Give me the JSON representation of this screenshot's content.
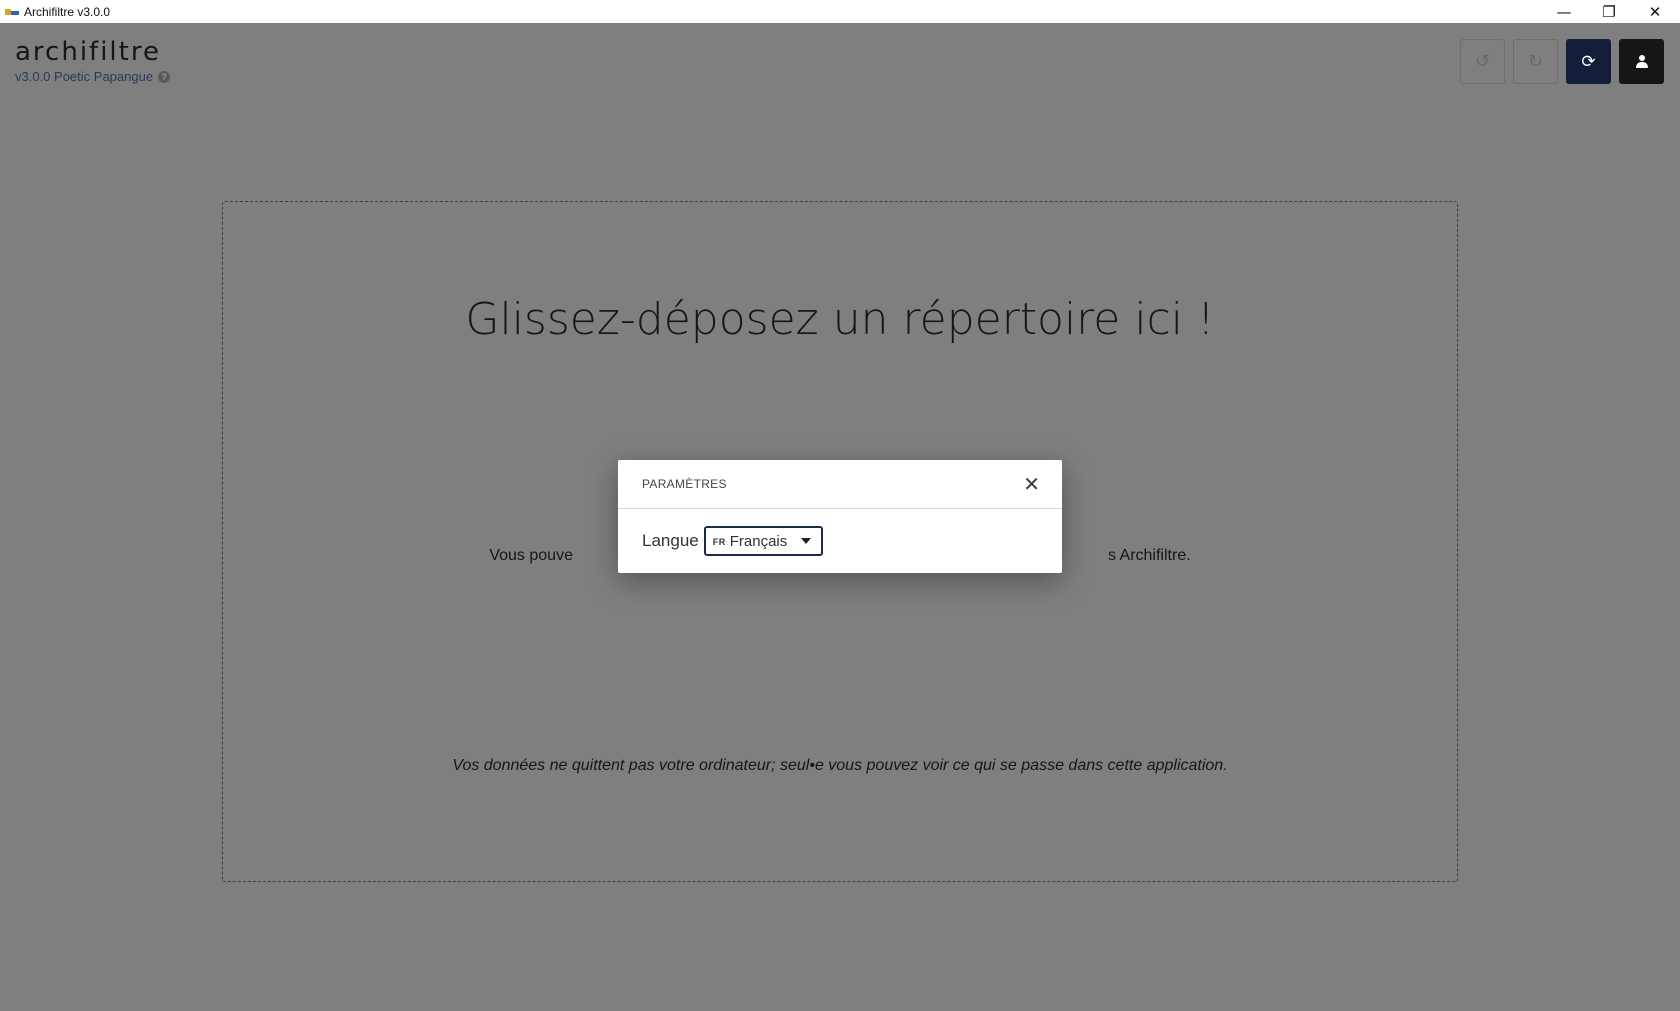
{
  "window": {
    "title": "Archifiltre v3.0.0",
    "minimize_icon": "—",
    "maximize_icon": "❐",
    "close_icon": "✕"
  },
  "header": {
    "app_name": "archifiltre",
    "version": "v3.0.0 Poetic Papangue",
    "help_icon": "?",
    "toolbar": {
      "undo_icon": "↺",
      "redo_icon": "↻",
      "reload_icon": "⟳"
    }
  },
  "dropzone": {
    "title": "Glissez-déposez un répertoire ici !",
    "subtitle_left": "Vous pouve",
    "subtitle_right": "s Archifiltre.",
    "footer": "Vos données ne quittent pas votre ordinateur; seul•e vous pouvez voir ce qui se passe dans cette application."
  },
  "modal": {
    "title": "PARAMÈTRES",
    "close_icon": "✕",
    "language_label": "Langue",
    "language_flag": "FR",
    "language_value": "Français"
  }
}
